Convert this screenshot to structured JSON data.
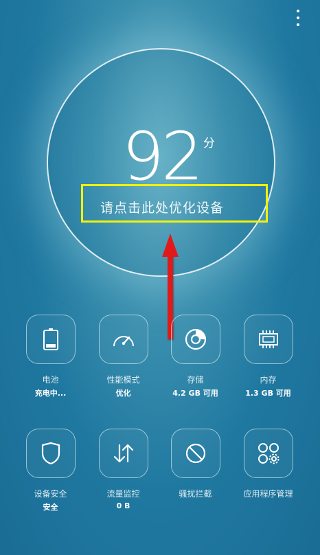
{
  "score": {
    "value": "92",
    "unit": "分"
  },
  "optimize_prompt": "请点击此处优化设备",
  "tools": [
    {
      "label": "电池",
      "sub": "充电中...",
      "icon": "battery-icon"
    },
    {
      "label": "性能模式",
      "sub": "优化",
      "icon": "speedometer-icon"
    },
    {
      "label": "存储",
      "sub": "4.2 GB 可用",
      "icon": "storage-disc-icon"
    },
    {
      "label": "内存",
      "sub": "1.3 GB 可用",
      "icon": "memory-chip-icon"
    },
    {
      "label": "设备安全",
      "sub": "安全",
      "icon": "shield-icon"
    },
    {
      "label": "流量监控",
      "sub": "0 B",
      "icon": "data-traffic-icon"
    },
    {
      "label": "骚扰拦截",
      "sub": "",
      "icon": "block-icon"
    },
    {
      "label": "应用程序管理",
      "sub": "",
      "icon": "app-grid-gear-icon"
    }
  ],
  "colors": {
    "annotation_box": "#f2f20a",
    "annotation_arrow": "#e01a1a",
    "background": "#1f78a0"
  }
}
